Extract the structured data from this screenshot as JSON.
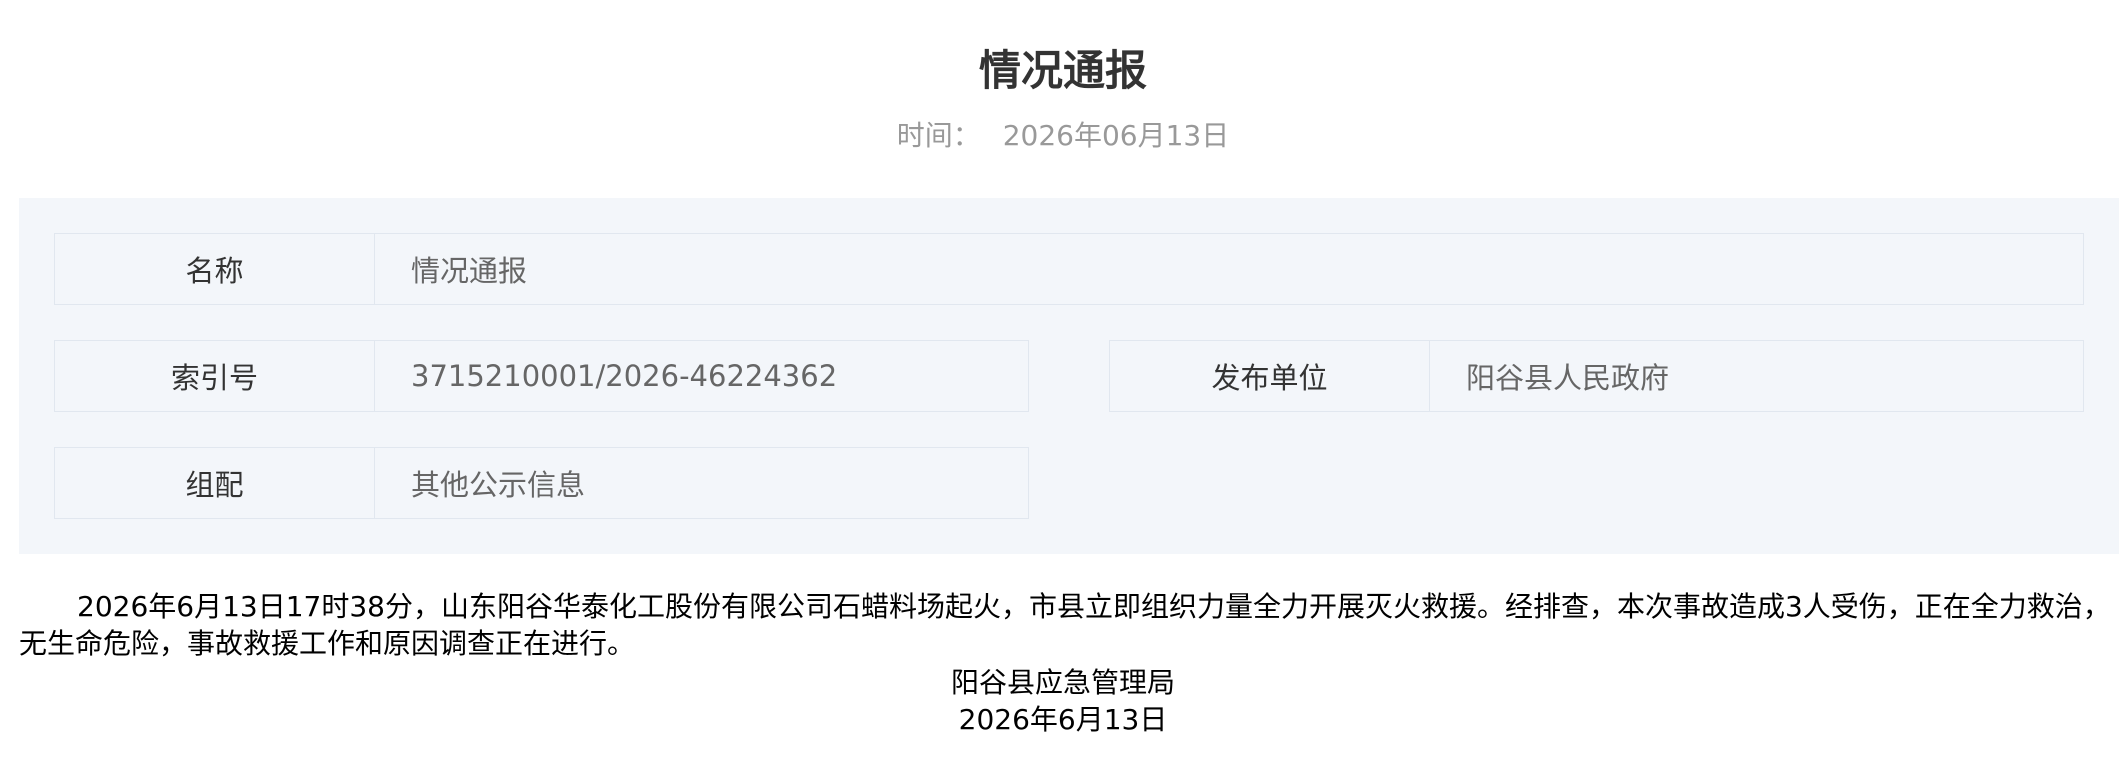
{
  "header": {
    "title": "情况通报",
    "date_label": "时间：",
    "date_value": "2026年06月13日"
  },
  "meta": {
    "name_key": "名称",
    "name_value": "情况通报",
    "index_key": "索引号",
    "index_value": "3715210001/2026-46224362",
    "publisher_key": "发布单位",
    "publisher_value": "阳谷县人民政府",
    "category_key": "组配",
    "category_value": "其他公示信息"
  },
  "content": {
    "paragraph": "2026年6月13日17时38分，山东阳谷华泰化工股份有限公司石蜡料场起火，市县立即组织力量全力开展灭火救援。经排查，本次事故造成3人受伤，正在全力救治，无生命危险，事故救援工作和原因调查正在进行。",
    "signature_org": "阳谷县应急管理局",
    "signature_date": "2026年6月13日"
  }
}
